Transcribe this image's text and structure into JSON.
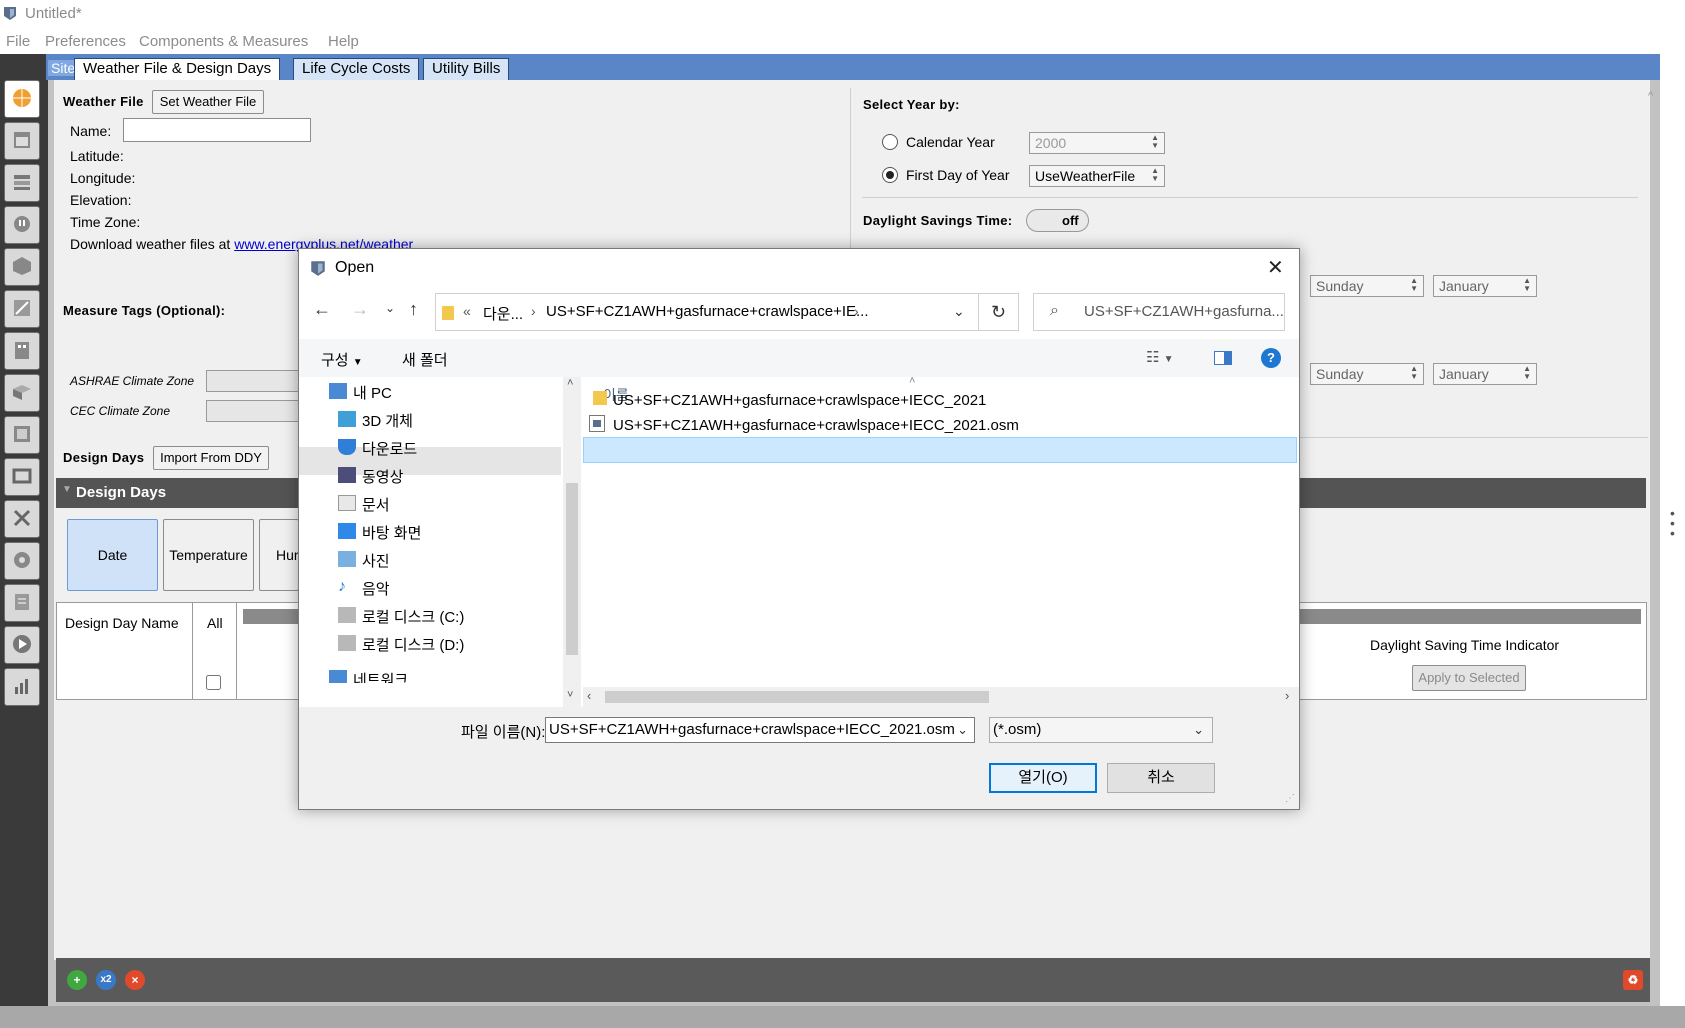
{
  "window": {
    "title": "Untitled*"
  },
  "menu": [
    "File",
    "Preferences",
    "Components & Measures",
    "Help"
  ],
  "tabs": {
    "site": "Site",
    "weather": "Weather File & Design Days",
    "lcc": "Life Cycle Costs",
    "utility": "Utility Bills"
  },
  "weather": {
    "heading": "Weather File",
    "set_button": "Set Weather File",
    "name_label": "Name:",
    "name_value": "",
    "latitude_label": "Latitude:",
    "longitude_label": "Longitude:",
    "elevation_label": "Elevation:",
    "timezone_label": "Time Zone:",
    "download_prefix": "Download weather files at ",
    "download_link": "www.energyplus.net/weather"
  },
  "measure_tags": {
    "heading": "Measure Tags (Optional):",
    "ashrae_label": "ASHRAE Climate Zone",
    "cec_label": "CEC Climate Zone"
  },
  "design_days": {
    "heading": "Design Days",
    "import_button": "Import From DDY",
    "section_title": "Design Days",
    "tabs": [
      "Date",
      "Temperature",
      "Hur"
    ],
    "col_name": "Design Day Name",
    "col_all": "All",
    "dst_indicator": "Daylight Saving Time Indicator",
    "apply_button": "Apply to Selected"
  },
  "year": {
    "heading": "Select Year by:",
    "calendar_label": "Calendar Year",
    "calendar_value": "2000",
    "first_day_label": "First Day of Year",
    "first_day_value": "UseWeatherFile",
    "selected": "first_day"
  },
  "dst": {
    "heading": "Daylight Savings Time:",
    "toggle": "off",
    "start_day": "Sunday",
    "start_month": "January",
    "end_day": "Sunday",
    "end_month": "January"
  },
  "dialog": {
    "title": "Open",
    "breadcrumb_prefix": "«",
    "breadcrumb_1": "다운...",
    "breadcrumb_2": "US+SF+CZ1AWH+gasfurnace+crawlspace+IE...",
    "search_placeholder": "US+SF+CZ1AWH+gasfurna...",
    "organize": "구성",
    "new_folder": "새 폴더",
    "nav_items": [
      "내 PC",
      "3D 개체",
      "다운로드",
      "동영상",
      "문서",
      "바탕 화면",
      "사진",
      "음악",
      "로컬 디스크 (C:)",
      "로컬 디스크 (D:)",
      "네트워크"
    ],
    "column_name": "이름",
    "files": [
      {
        "name": "US+SF+CZ1AWH+gasfurnace+crawlspace+IECC_2021",
        "type": "folder"
      },
      {
        "name": "US+SF+CZ1AWH+gasfurnace+crawlspace+IECC_2021.osm",
        "type": "file"
      }
    ],
    "filename_label": "파일 이름(N):",
    "filename_value": "US+SF+CZ1AWH+gasfurnace+crawlspace+IECC_2021.osm",
    "filetype_value": "(*.osm)",
    "open_button": "열기(O)",
    "cancel_button": "취소"
  },
  "colors": {
    "tab_bar": "#5a86c8",
    "dialog_accent": "#0078d7",
    "selection": "#cce8ff",
    "toolbar_dark": "#3a3a3a"
  }
}
